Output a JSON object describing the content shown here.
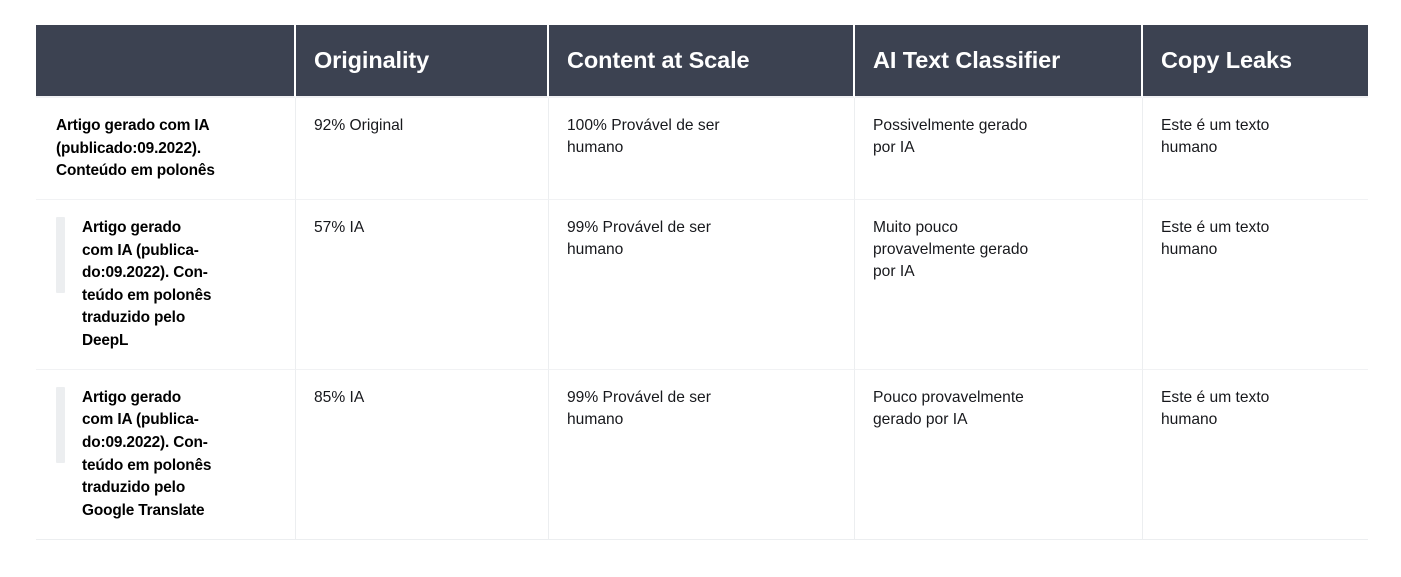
{
  "table": {
    "columns": [
      {
        "key": "label",
        "header": ""
      },
      {
        "key": "originality",
        "header": "Originality"
      },
      {
        "key": "content_at_scale",
        "header": "Content at Scale"
      },
      {
        "key": "ai_text_classifier",
        "header": "AI Text Classifier"
      },
      {
        "key": "copy_leaks",
        "header": "Copy Leaks"
      }
    ],
    "header_background": "#3c4251",
    "header_text_color": "#ffffff",
    "rows": [
      {
        "indented": false,
        "label_lines": [
          "Artigo gerado com IA",
          "(publicado:09.2022).",
          "Conteúdo em polonês"
        ],
        "label": "Artigo gerado com IA (publicado:09.2022). Conteúdo em polonês",
        "originality": "92% Original",
        "content_at_scale_lines": [
          "100% Provável de ser",
          "humano"
        ],
        "content_at_scale": "100% Provável de ser humano",
        "ai_text_classifier_lines": [
          "Possivelmente gerado",
          "por IA"
        ],
        "ai_text_classifier": "Possivelmente gerado por IA",
        "copy_leaks_lines": [
          "Este é um texto",
          "humano"
        ],
        "copy_leaks": "Este é um texto humano"
      },
      {
        "indented": true,
        "label_lines": [
          "Artigo gerado",
          "com IA (publica-",
          "do:09.2022). Con-",
          "teúdo em polonês",
          "traduzido pelo",
          "DeepL"
        ],
        "label": "Artigo gerado com IA (publicado:09.2022). Conteúdo em polonês traduzido pelo DeepL",
        "originality": "57% IA",
        "content_at_scale_lines": [
          "99% Provável de ser",
          "humano"
        ],
        "content_at_scale": "99% Provável de ser humano",
        "ai_text_classifier_lines": [
          "Muito pouco",
          "provavelmente gerado",
          "por IA"
        ],
        "ai_text_classifier": "Muito pouco provavelmente gerado por IA",
        "copy_leaks_lines": [
          "Este é um texto",
          "humano"
        ],
        "copy_leaks": "Este é um texto humano"
      },
      {
        "indented": true,
        "label_lines": [
          "Artigo gerado",
          "com IA (publica-",
          "do:09.2022). Con-",
          "teúdo em polonês",
          "traduzido pelo",
          "Google Translate"
        ],
        "label": "Artigo gerado com IA (publicado:09.2022). Conteúdo em polonês traduzido pelo Google Translate",
        "originality": "85% IA",
        "content_at_scale_lines": [
          "99% Provável de ser",
          "humano"
        ],
        "content_at_scale": "99% Provável de ser humano",
        "ai_text_classifier_lines": [
          "Pouco provavelmente",
          "gerado por IA"
        ],
        "ai_text_classifier": "Pouco provavelmente gerado por IA",
        "copy_leaks_lines": [
          "Este é um texto",
          "humano"
        ],
        "copy_leaks": "Este é um texto humano"
      }
    ]
  }
}
